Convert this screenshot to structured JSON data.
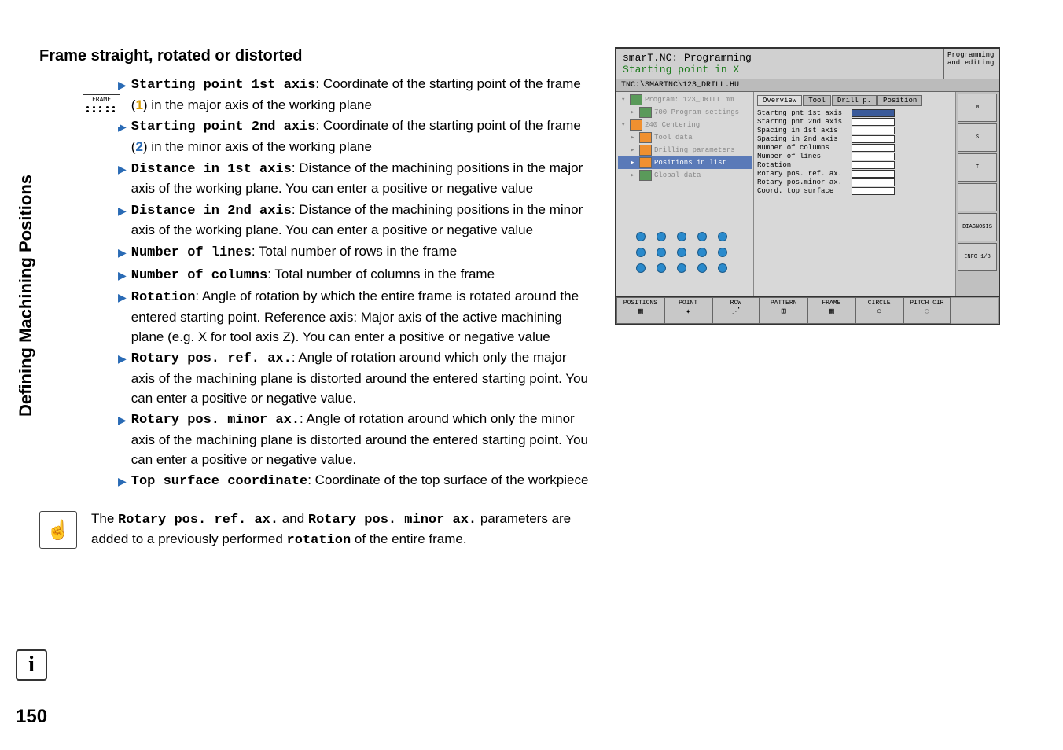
{
  "page": {
    "vertical_label": "Defining Machining Positions",
    "section_title": "Frame straight, rotated or distorted",
    "page_number": "150",
    "frame_icon_label": "FRAME"
  },
  "items": [
    {
      "term": "Starting point 1st axis",
      "text_a": ": Coordinate of the starting point of the frame (",
      "num": "1",
      "num_class": "colored-1",
      "text_b": ") in the major axis of the working plane"
    },
    {
      "term": "Starting point 2nd axis",
      "text_a": ": Coordinate of the starting point of the frame (",
      "num": "2",
      "num_class": "colored-2",
      "text_b": ") in the minor axis of the working plane"
    },
    {
      "term": "Distance in 1st axis",
      "text_a": ": Distance of the machining positions in the major axis of the working plane. You can enter a positive or negative value",
      "num": "",
      "num_class": "",
      "text_b": ""
    },
    {
      "term": "Distance in 2nd axis",
      "text_a": ": Distance of the machining positions in the minor axis of the working plane. You can enter a positive or negative value",
      "num": "",
      "num_class": "",
      "text_b": ""
    },
    {
      "term": "Number of lines",
      "text_a": ": Total number of rows in the frame",
      "num": "",
      "num_class": "",
      "text_b": ""
    },
    {
      "term": "Number of columns",
      "text_a": ": Total number of columns in the frame",
      "num": "",
      "num_class": "",
      "text_b": ""
    },
    {
      "term": "Rotation",
      "text_a": ": Angle of rotation by which the entire frame is rotated around the entered starting point. Reference axis: Major axis of the active machining plane (e.g. X for tool axis Z). You can enter a positive or negative value",
      "num": "",
      "num_class": "",
      "text_b": ""
    },
    {
      "term": "Rotary pos. ref. ax.",
      "text_a": ": Angle of rotation around which only the major axis of the machining plane is distorted around the entered starting point. You can enter a positive or negative value.",
      "num": "",
      "num_class": "",
      "text_b": ""
    },
    {
      "term": "Rotary pos. minor ax.",
      "text_a": ": Angle of rotation around which only the minor axis of the machining plane is distorted around the entered starting point. You can enter a positive or negative value.",
      "num": "",
      "num_class": "",
      "text_b": ""
    },
    {
      "term": "Top surface coordinate",
      "text_a": ": Coordinate of the top surface of the workpiece",
      "num": "",
      "num_class": "",
      "text_b": ""
    }
  ],
  "note": {
    "pre": "The ",
    "t1": "Rotary pos. ref. ax.",
    "mid1": " and ",
    "t2": "Rotary pos. minor ax.",
    "mid2": " parameters are added to a previously performed ",
    "t3": "rotation",
    "post": " of the entire frame."
  },
  "cnc": {
    "title1": "smarT.NC: Programming",
    "title2": "Starting point in X",
    "mode1": "Programming",
    "mode2": "and editing",
    "path": "TNC:\\SMARTNC\\123_DRILL.HU",
    "tree": [
      {
        "label": "Program: 123_DRILL mm",
        "icon": "green",
        "indent": 0
      },
      {
        "label": "700 Program settings",
        "icon": "green",
        "indent": 1
      },
      {
        "label": "240 Centering",
        "icon": "orange",
        "indent": 0
      },
      {
        "label": "Tool data",
        "icon": "orange",
        "indent": 1
      },
      {
        "label": "Drilling parameters",
        "icon": "orange",
        "indent": 1
      },
      {
        "label": "Positions in list",
        "icon": "orange",
        "indent": 1,
        "selected": true
      },
      {
        "label": "Global data",
        "icon": "green",
        "indent": 1
      }
    ],
    "tabs": [
      "Overview",
      "Tool",
      "Drill p.",
      "Position"
    ],
    "form": [
      {
        "label": "Startng pnt 1st axis",
        "highlight": true
      },
      {
        "label": "Startng pnt 2nd axis"
      },
      {
        "label": "Spacing in 1st axis"
      },
      {
        "label": "Spacing in 2nd axis"
      },
      {
        "label": "Number of columns"
      },
      {
        "label": "Number of lines"
      },
      {
        "label": "Rotation"
      },
      {
        "label": "Rotary pos. ref. ax."
      },
      {
        "label": "Rotary pos.minor ax."
      },
      {
        "label": "Coord. top surface"
      }
    ],
    "side": [
      {
        "label": "M"
      },
      {
        "label": "S"
      },
      {
        "label": "T"
      },
      {
        "label": ""
      },
      {
        "label": "DIAGNOSIS"
      },
      {
        "label": "INFO 1/3"
      }
    ],
    "soft": [
      "POSITIONS",
      "POINT",
      "ROW",
      "PATTERN",
      "FRAME",
      "CIRCLE",
      "PITCH CIR"
    ]
  }
}
